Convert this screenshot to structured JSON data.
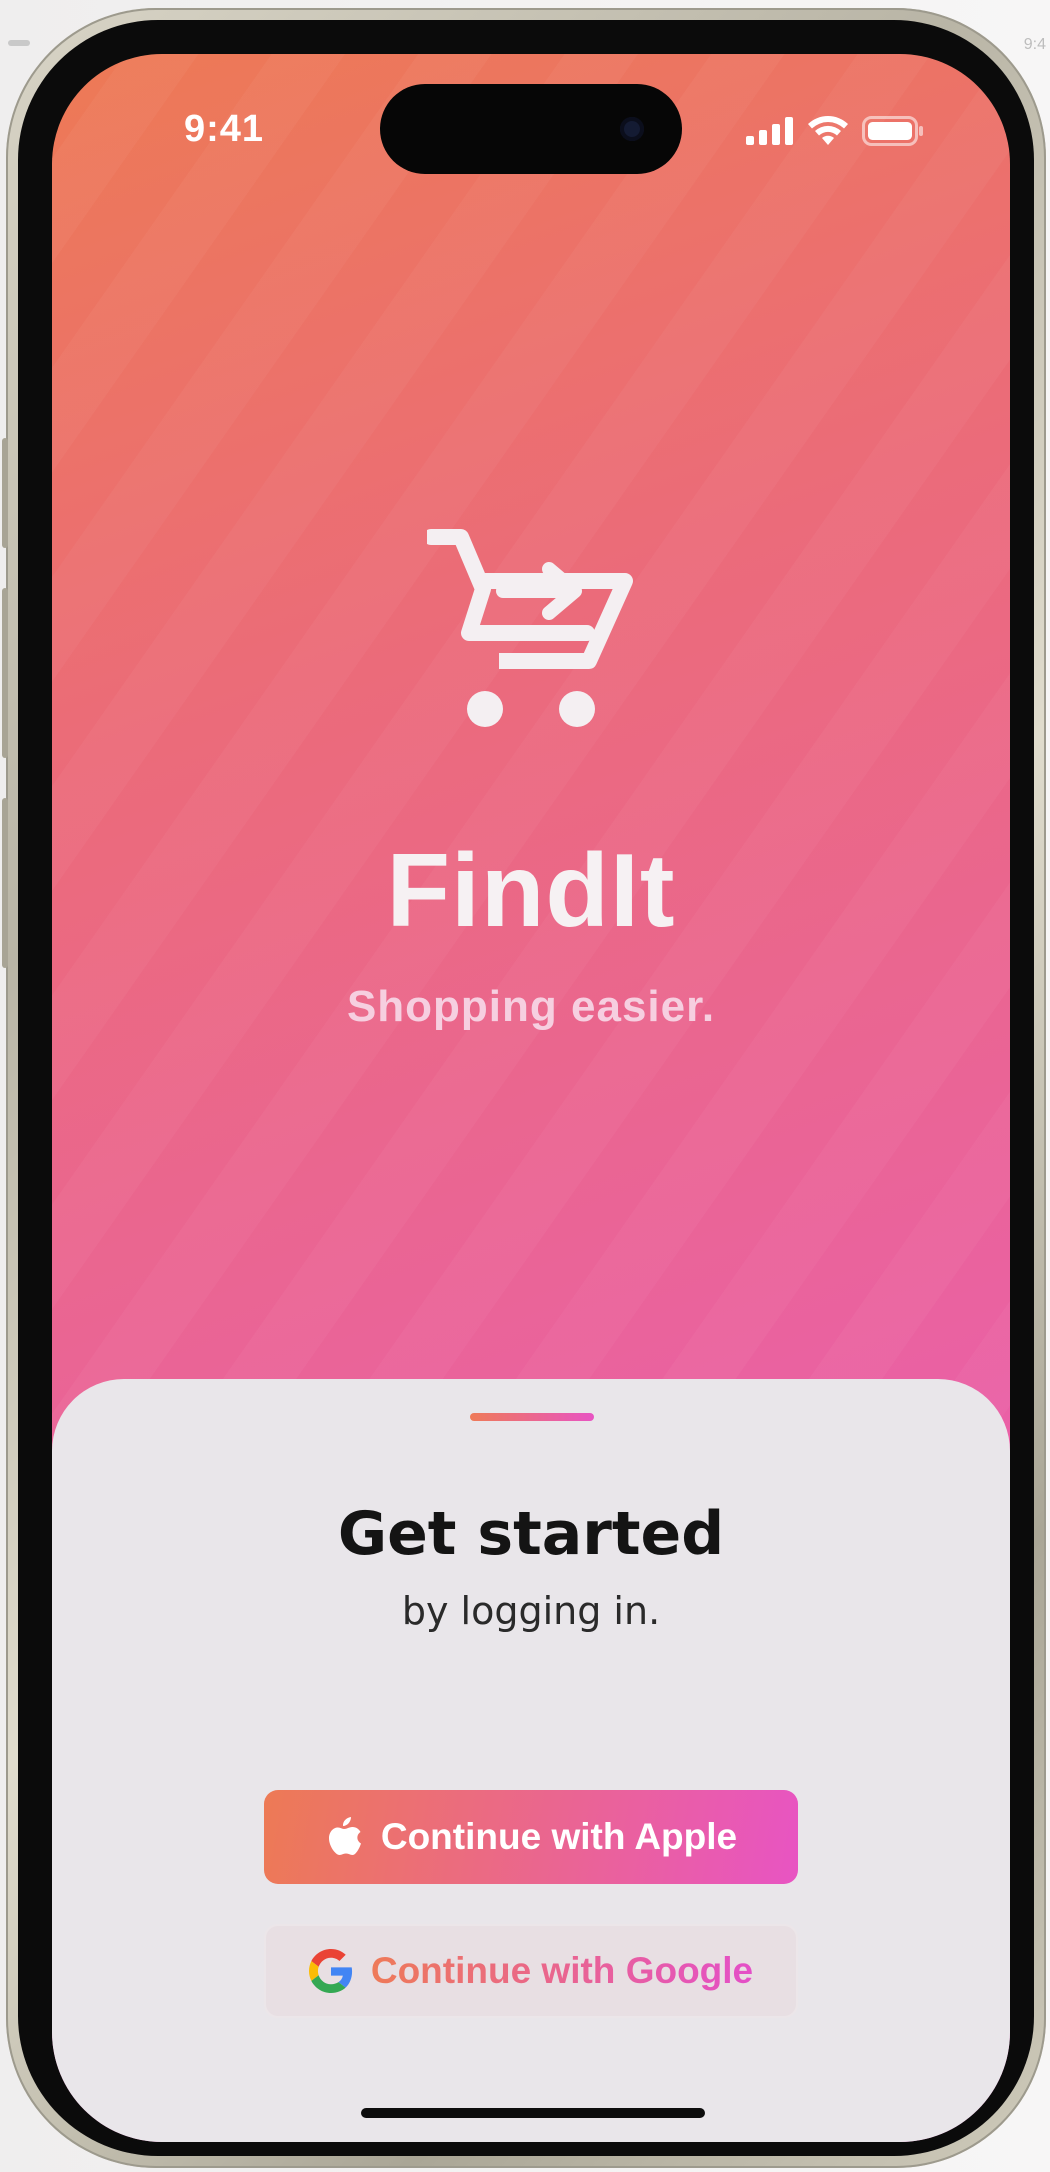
{
  "status_bar": {
    "time": "9:41"
  },
  "app": {
    "name": "FindIt",
    "tagline": "Shopping easier."
  },
  "sheet": {
    "title": "Get started",
    "subtitle": "by logging in.",
    "apple_button": "Continue with Apple",
    "google_button": "Continue with Google"
  },
  "background_peek": {
    "time": "9:4"
  },
  "colors": {
    "gradient_start": "#ED7A55",
    "gradient_end": "#E853C5",
    "sheet_bg": "#E9E6EA",
    "title_text": "#141414"
  },
  "icons": [
    "cart-arrow-icon",
    "signal-icon",
    "wifi-icon",
    "battery-icon",
    "apple-logo-icon",
    "google-logo-icon"
  ]
}
